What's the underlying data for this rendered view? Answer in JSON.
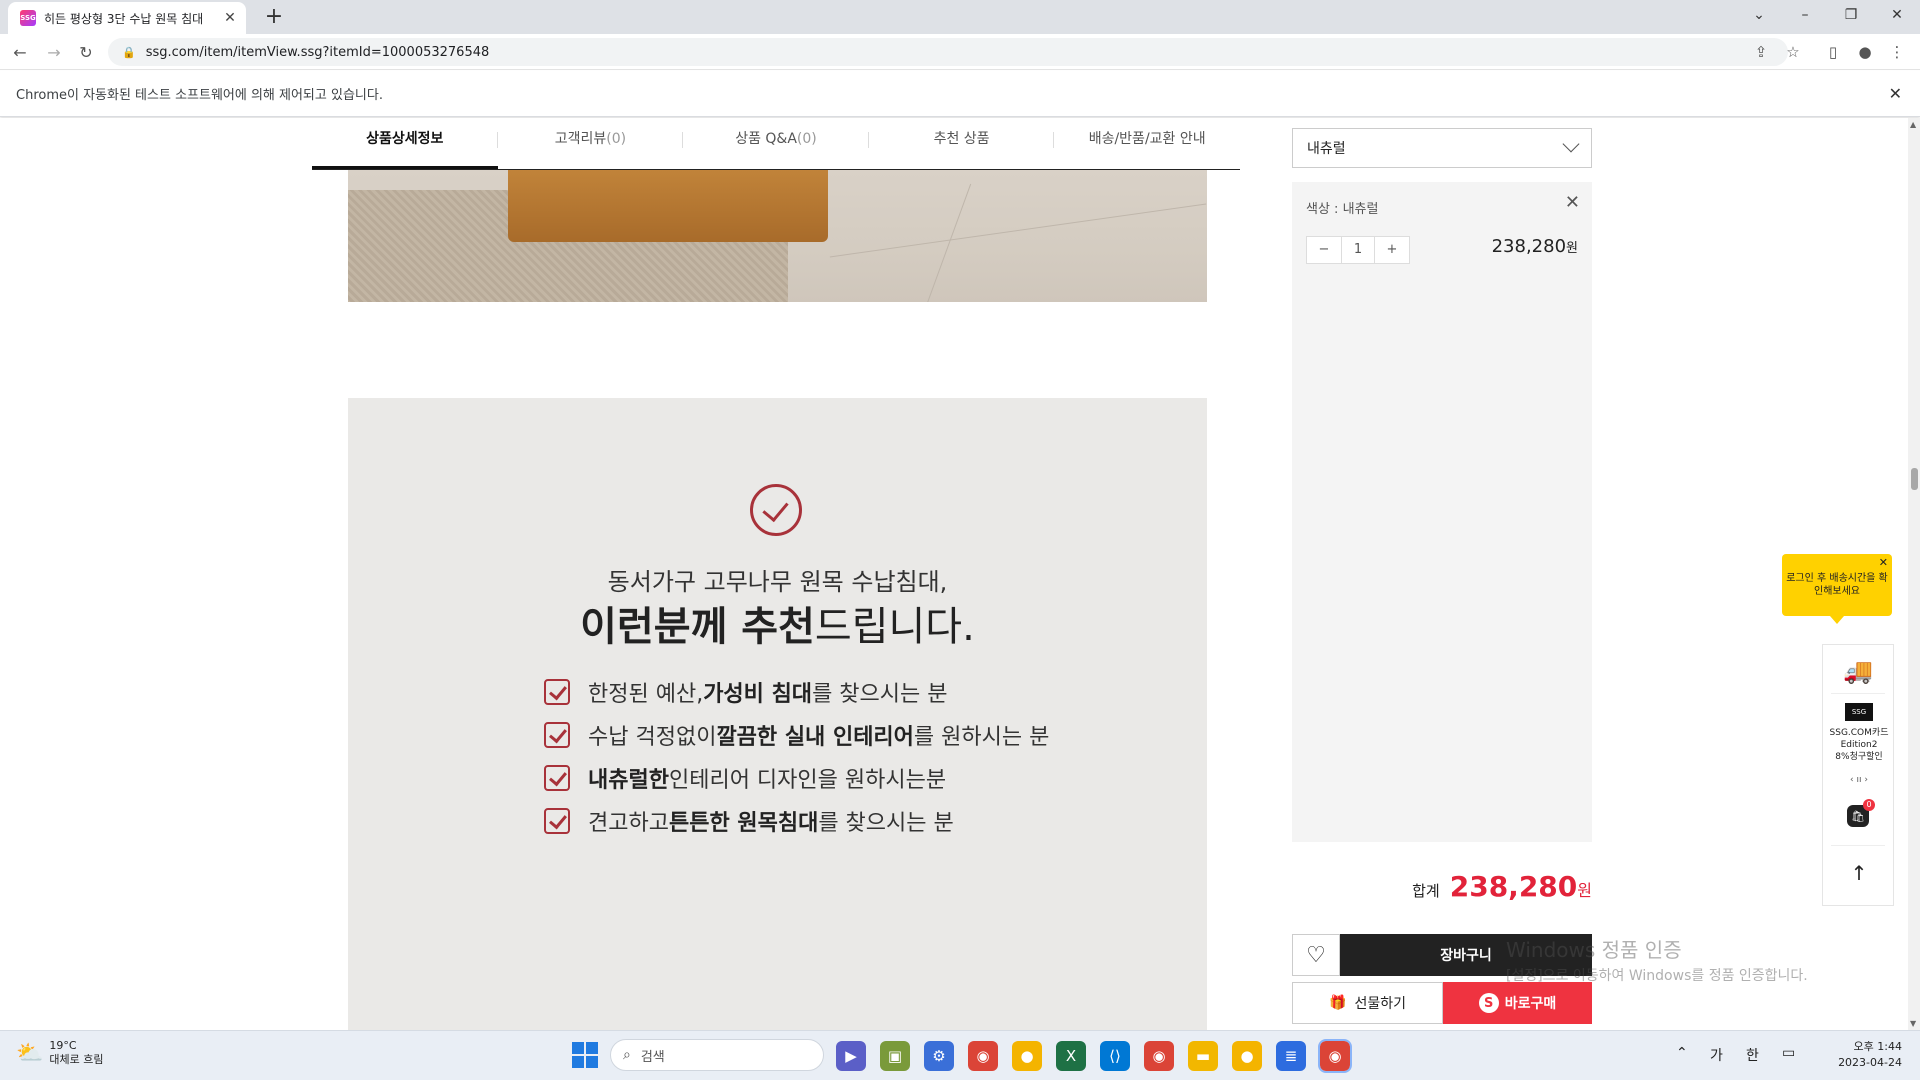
{
  "browser": {
    "tab_title": "히든 평상형 3단 수납 원목 침대",
    "favicon_text": "SSG",
    "url": "ssg.com/item/itemView.ssg?itemId=1000053276548",
    "infobar_text": "Chrome이 자동화된 테스트 소프트웨어에 의해 제어되고 있습니다.",
    "new_tab": "+",
    "win_controls": [
      "⌄",
      "–",
      "❐",
      "✕"
    ]
  },
  "detail_tabs": [
    {
      "label": "상품상세정보",
      "count": ""
    },
    {
      "label": "고객리뷰",
      "count": "(0)"
    },
    {
      "label": "상품 Q&A",
      "count": "(0)"
    },
    {
      "label": "추천 상품",
      "count": ""
    },
    {
      "label": "배송/반품/교환 안내",
      "count": ""
    }
  ],
  "recommend": {
    "subtitle": "동서가구 고무나무 원목 수납침대,",
    "headline_bold": "이런분께 추천",
    "headline_rest": "드립니다.",
    "items": [
      {
        "pre": "한정된 예산, ",
        "bold": "가성비 침대",
        "post": "를 찾으시는 분"
      },
      {
        "pre": "수납 걱정없이 ",
        "bold": "깔끔한 실내 인테리어",
        "post": "를 원하시는 분"
      },
      {
        "pre": "",
        "bold": "내츄럴한",
        "post": " 인테리어 디자인을 원하시는분"
      },
      {
        "pre": "견고하고 ",
        "bold": "튼튼한 원목침대",
        "post": "를 찾으시는 분"
      }
    ]
  },
  "options": {
    "selected": "내츄럴",
    "color_label": "색상 : 내츄럴",
    "qty_minus": "−",
    "qty_value": "1",
    "qty_plus": "+",
    "price": "238,280",
    "won": "원",
    "total_label": "합계",
    "total_value": "238,280",
    "total_won": "원",
    "cart_label": "장바구니",
    "gift_label": "선물하기",
    "buy_label": "바로구매",
    "buy_icon_text": "S"
  },
  "side": {
    "tooltip": "로그인 후 배송시간을 확인해보세요",
    "ssg_logo": "SSG",
    "card_line1": "SSG.COM카드",
    "card_line2": "Edition2",
    "card_line3": "8%청구할인",
    "pager": "‹  ıı  ›",
    "cart_badge": "0"
  },
  "watermark": {
    "line1": "Windows 정품 인증",
    "line2": "[설정]으로 이동하여 Windows를 정품 인증합니다."
  },
  "taskbar": {
    "temp": "19°C",
    "weather": "대체로 흐림",
    "search_placeholder": "검색",
    "ime1": "가",
    "ime2": "한",
    "time": "오후 1:44",
    "date": "2023-04-24"
  },
  "colors": {
    "accent_red": "#ef3340",
    "price_red": "#e2233a",
    "check_red": "#a8323a",
    "tooltip_yellow": "#ffd100"
  }
}
